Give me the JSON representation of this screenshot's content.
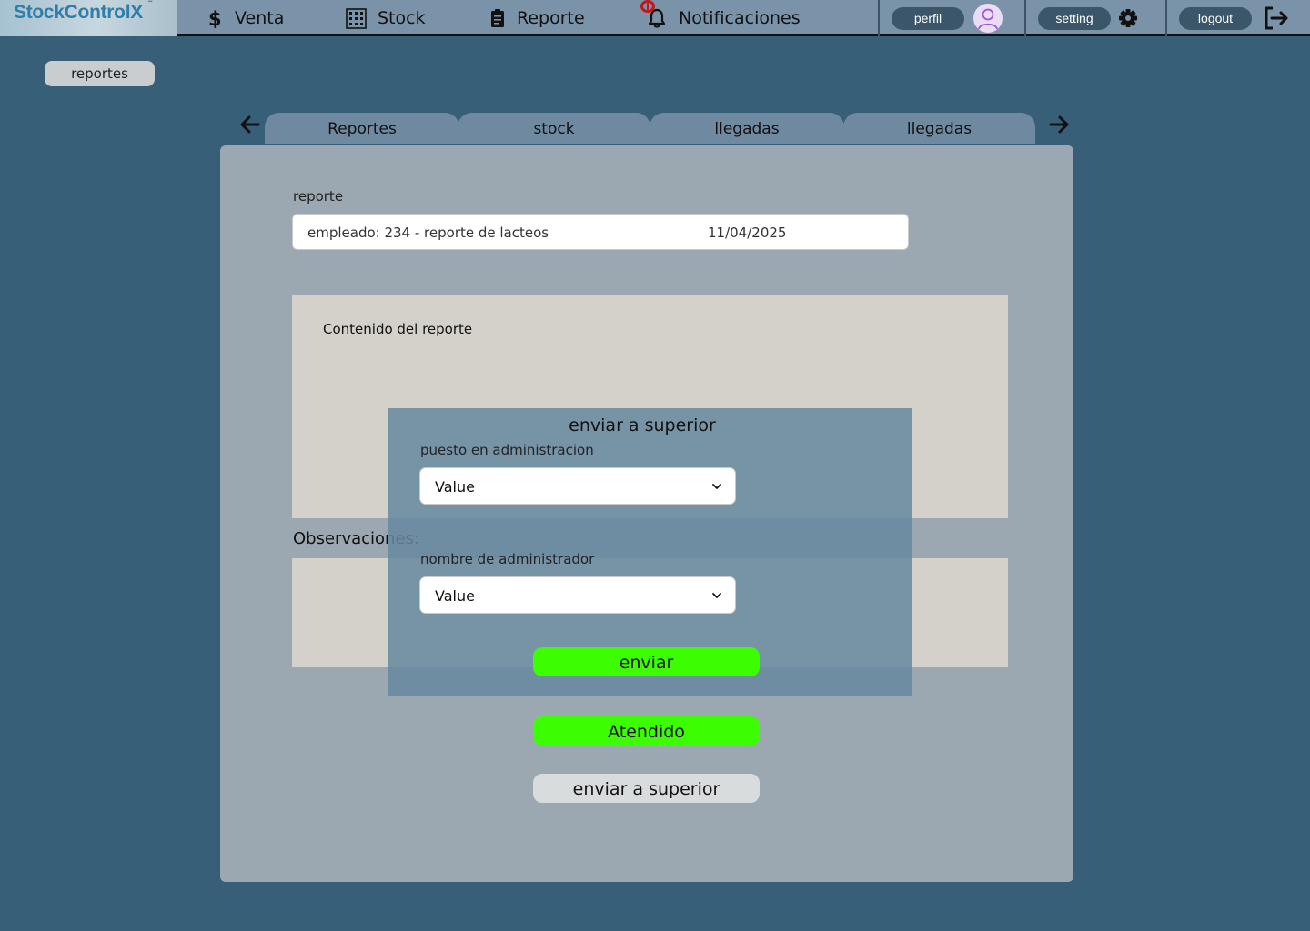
{
  "app": {
    "logo": "StockControlX",
    "logo_mark": "˜"
  },
  "nav": {
    "items": [
      {
        "label": "Venta",
        "icon": "dollar-icon"
      },
      {
        "label": "Stock",
        "icon": "grid-icon"
      },
      {
        "label": "Reporte",
        "icon": "clipboard-icon"
      },
      {
        "label": "Notificaciones",
        "icon": "bell-icon"
      }
    ],
    "perfil": "perfil",
    "setting": "setting",
    "logout": "logout"
  },
  "breadcrumb": "reportes",
  "tabs": [
    "Reportes",
    "stock",
    "llegadas",
    "llegadas"
  ],
  "reporte": {
    "label": "reporte",
    "summary": "empleado: 234 - reporte de lacteos",
    "date": "11/04/2025"
  },
  "content": {
    "title": "Contenido del reporte"
  },
  "observaciones": {
    "label": "Observaciones:"
  },
  "buttons": {
    "atendido": "Atendido",
    "enviar_superior": "enviar a superior"
  },
  "modal": {
    "title": "enviar a superior",
    "field1_label": "puesto en administracion",
    "field1_value": "Value",
    "field2_label": "nombre de administrador",
    "field2_value": "Value",
    "submit": "enviar"
  },
  "colors": {
    "background": "#375f77",
    "topbar": "#7a93a8",
    "panel": "#9ca8b1",
    "green": "#3dfd02",
    "notification": "#c4161c"
  }
}
